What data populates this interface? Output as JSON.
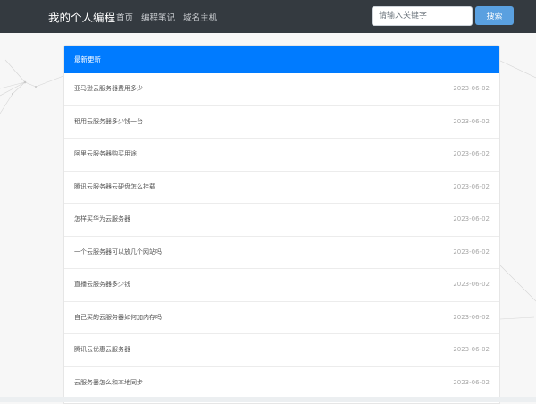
{
  "navbar": {
    "brand": "我的个人编程",
    "links": [
      "首页",
      "编程笔记",
      "域名主机"
    ],
    "search_placeholder": "请输入关键字",
    "search_value": "",
    "search_button": "搜索"
  },
  "card": {
    "header": "最新更新",
    "items": [
      {
        "title": "亚马逊云服务器费用多少",
        "date": "2023-06-02"
      },
      {
        "title": "租用云服务器多少钱一台",
        "date": "2023-06-02"
      },
      {
        "title": "阿里云服务器购买用途",
        "date": "2023-06-02"
      },
      {
        "title": "腾讯云服务器云硬盘怎么挂载",
        "date": "2023-06-02"
      },
      {
        "title": "怎样买华为云服务器",
        "date": "2023-06-02"
      },
      {
        "title": "一个云服务器可以放几个网站吗",
        "date": "2023-06-02"
      },
      {
        "title": "直播云服务器多少钱",
        "date": "2023-06-02"
      },
      {
        "title": "自己买的云服务器如何加内存吗",
        "date": "2023-06-02"
      },
      {
        "title": "腾讯云优惠云服务器",
        "date": "2023-06-02"
      },
      {
        "title": "云服务器怎么和本地同步",
        "date": "2023-06-02"
      }
    ]
  },
  "colors": {
    "navbar_bg": "#343a40",
    "header_bg": "#007bff",
    "search_button_bg": "#5aa0e0"
  }
}
